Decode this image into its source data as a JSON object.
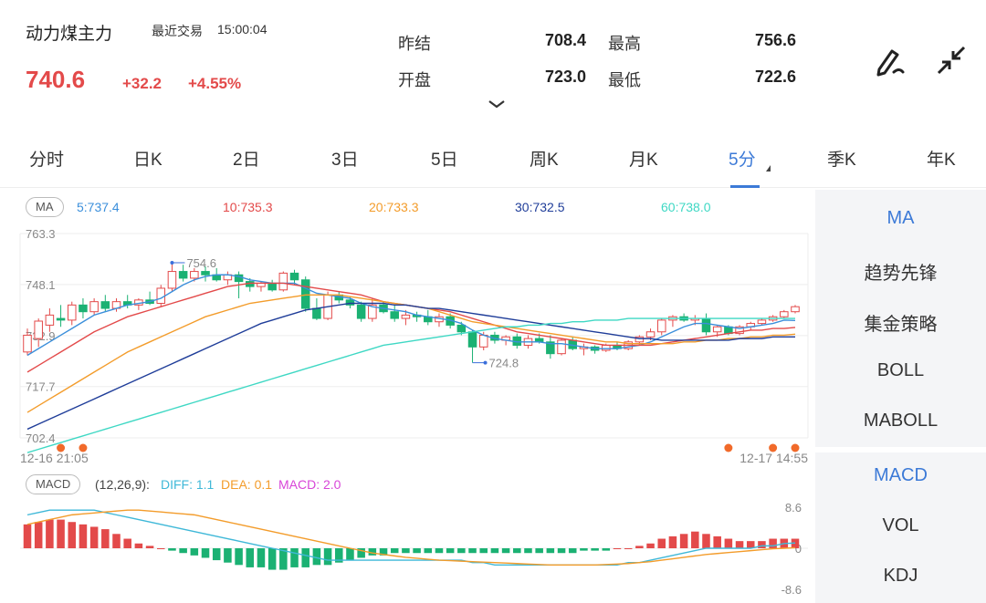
{
  "header": {
    "title": "动力煤主力",
    "trade_label": "最近交易",
    "trade_time": "15:00:04",
    "price": "740.6",
    "change": "+32.2",
    "change_pct": "+4.55%",
    "quotes": {
      "prev_settle_label": "昨结",
      "prev_settle": "708.4",
      "high_label": "最高",
      "high": "756.6",
      "open_label": "开盘",
      "open": "723.0",
      "low_label": "最低",
      "low": "722.6"
    },
    "icons": [
      "draw-icon",
      "collapse-icon",
      "expand-chevron-icon"
    ]
  },
  "tabs": [
    {
      "label": "分时"
    },
    {
      "label": "日K"
    },
    {
      "label": "2日"
    },
    {
      "label": "3日"
    },
    {
      "label": "5日"
    },
    {
      "label": "周K"
    },
    {
      "label": "月K"
    },
    {
      "label": "5分",
      "active": true
    },
    {
      "label": "季K"
    },
    {
      "label": "年K"
    }
  ],
  "ma_legend": {
    "badge": "MA",
    "items": [
      {
        "label": "5:737.4",
        "color": "#3b8fdb"
      },
      {
        "label": "10:735.3",
        "color": "#e34a4a"
      },
      {
        "label": "20:733.3",
        "color": "#f39c2b"
      },
      {
        "label": "30:732.5",
        "color": "#1f3d99"
      },
      {
        "label": "60:738.0",
        "color": "#3fd8c4"
      }
    ]
  },
  "macd_legend": {
    "badge": "MACD",
    "params": "(12,26,9):",
    "diff": "DIFF: 1.1",
    "diff_color": "#3fb8d8",
    "dea": "DEA: 0.1",
    "dea_color": "#f39c2b",
    "macd": "MACD: 2.0",
    "macd_color": "#d846d8"
  },
  "side_panel": {
    "top_items": [
      {
        "label": "MA",
        "active": true
      },
      {
        "label": "趋势先锋"
      },
      {
        "label": "集金策略"
      },
      {
        "label": "BOLL"
      },
      {
        "label": "MABOLL"
      }
    ],
    "bottom_items": [
      {
        "label": "MACD",
        "active": true
      },
      {
        "label": "VOL"
      },
      {
        "label": "KDJ"
      }
    ]
  },
  "chart_data": {
    "type": "candlestick",
    "timeframe": "5分",
    "x_start_label": "12-16 21:05",
    "x_end_label": "12-17 14:55",
    "ylim": [
      702.4,
      763.3
    ],
    "y_ticks": [
      "763.3",
      "748.1",
      "732.9",
      "717.7",
      "702.4"
    ],
    "annotations": {
      "high": "754.6",
      "low": "724.8"
    },
    "candles": [
      [
        728.0,
        735.0,
        727.0,
        733.0
      ],
      [
        732.0,
        738.0,
        729.5,
        737.2
      ],
      [
        736.0,
        741.0,
        734.0,
        739.0
      ],
      [
        738.0,
        742.0,
        735.5,
        737.5
      ],
      [
        737.5,
        743.0,
        736.0,
        742.0
      ],
      [
        742.0,
        744.0,
        738.0,
        740.0
      ],
      [
        740.0,
        744.0,
        739.0,
        743.0
      ],
      [
        743.0,
        745.0,
        740.0,
        741.0
      ],
      [
        741.0,
        744.0,
        740.0,
        743.0
      ],
      [
        743.0,
        745.0,
        741.0,
        742.0
      ],
      [
        742.0,
        744.0,
        740.5,
        743.5
      ],
      [
        743.5,
        746.0,
        742.0,
        742.5
      ],
      [
        742.5,
        748.0,
        741.5,
        747.0
      ],
      [
        747.0,
        754.6,
        746.0,
        752.0
      ],
      [
        752.0,
        754.0,
        749.0,
        750.0
      ],
      [
        750.0,
        753.0,
        749.0,
        752.0
      ],
      [
        752.0,
        753.5,
        749.0,
        751.0
      ],
      [
        751.0,
        753.0,
        749.0,
        749.5
      ],
      [
        749.5,
        752.0,
        748.0,
        751.0
      ],
      [
        751.0,
        752.0,
        744.0,
        749.0
      ],
      [
        749.0,
        750.0,
        746.0,
        747.5
      ],
      [
        747.5,
        749.0,
        746.0,
        748.5
      ],
      [
        748.5,
        749.5,
        746.0,
        746.5
      ],
      [
        746.5,
        752.0,
        746.0,
        751.5
      ],
      [
        751.5,
        752.5,
        748.0,
        749.5
      ],
      [
        749.5,
        750.5,
        740.0,
        741.0
      ],
      [
        741.0,
        744.0,
        737.5,
        738.0
      ],
      [
        738.0,
        746.0,
        737.5,
        745.0
      ],
      [
        745.0,
        746.0,
        742.5,
        743.5
      ],
      [
        743.5,
        744.5,
        741.0,
        742.0
      ],
      [
        742.0,
        743.0,
        737.0,
        738.0
      ],
      [
        738.0,
        744.0,
        737.0,
        742.0
      ],
      [
        742.0,
        743.0,
        739.5,
        740.0
      ],
      [
        740.0,
        742.0,
        737.0,
        738.0
      ],
      [
        738.0,
        740.5,
        736.0,
        739.0
      ],
      [
        739.0,
        740.0,
        737.0,
        738.5
      ],
      [
        738.5,
        740.5,
        736.0,
        737.0
      ],
      [
        737.0,
        739.5,
        735.5,
        738.5
      ],
      [
        738.5,
        739.5,
        735.0,
        736.0
      ],
      [
        736.0,
        737.0,
        733.0,
        734.0
      ],
      [
        734.0,
        734.5,
        724.8,
        729.5
      ],
      [
        729.5,
        734.0,
        728.5,
        733.0
      ],
      [
        733.0,
        734.0,
        730.5,
        731.5
      ],
      [
        731.5,
        733.0,
        730.0,
        732.5
      ],
      [
        732.5,
        733.5,
        729.0,
        730.0
      ],
      [
        730.0,
        733.0,
        729.0,
        732.0
      ],
      [
        732.0,
        733.5,
        730.5,
        731.0
      ],
      [
        731.0,
        733.0,
        726.0,
        727.5
      ],
      [
        727.5,
        732.0,
        727.0,
        731.5
      ],
      [
        731.5,
        732.5,
        728.5,
        729.0
      ],
      [
        729.0,
        730.5,
        727.0,
        729.5
      ],
      [
        729.5,
        730.0,
        727.5,
        728.5
      ],
      [
        728.5,
        730.5,
        728.0,
        730.0
      ],
      [
        730.0,
        731.0,
        728.5,
        729.0
      ],
      [
        729.0,
        731.5,
        728.5,
        731.0
      ],
      [
        731.0,
        733.0,
        730.0,
        732.5
      ],
      [
        732.5,
        735.0,
        731.5,
        734.0
      ],
      [
        734.0,
        738.0,
        733.0,
        737.5
      ],
      [
        737.5,
        739.0,
        735.5,
        738.5
      ],
      [
        738.5,
        739.5,
        737.0,
        737.5
      ],
      [
        737.5,
        739.0,
        736.0,
        738.0
      ],
      [
        738.0,
        739.5,
        733.0,
        734.0
      ],
      [
        734.0,
        736.0,
        732.5,
        735.5
      ],
      [
        735.5,
        736.0,
        733.0,
        733.5
      ],
      [
        733.5,
        736.0,
        733.0,
        735.5
      ],
      [
        735.5,
        737.0,
        734.5,
        736.5
      ],
      [
        736.5,
        738.0,
        736.0,
        737.5
      ],
      [
        737.5,
        739.0,
        737.0,
        738.5
      ],
      [
        738.5,
        740.5,
        738.0,
        740.0
      ],
      [
        740.0,
        742.0,
        739.5,
        741.5
      ]
    ],
    "ma_lines": [
      {
        "name": "MA5",
        "color": "#3b8fdb",
        "values": [
          727,
          729,
          731,
          733,
          735,
          737,
          739,
          740,
          741,
          742,
          742.5,
          743,
          744,
          746,
          748,
          749.5,
          750.5,
          751,
          751,
          750.5,
          749.5,
          749,
          748.5,
          748.5,
          748.5,
          747,
          745.5,
          745,
          744.5,
          744,
          742.5,
          741.5,
          741,
          740.5,
          740,
          739,
          738.5,
          738,
          737.5,
          736.5,
          734.5,
          733,
          732,
          731.5,
          731,
          731,
          731,
          730.5,
          730.5,
          730,
          729.5,
          729,
          729,
          729,
          729.5,
          730,
          731,
          732.5,
          734,
          735.5,
          736.5,
          736.5,
          736,
          735.5,
          735,
          735.5,
          736,
          736.5,
          737.5,
          737.4
        ]
      },
      {
        "name": "MA10",
        "color": "#e34a4a",
        "values": [
          722,
          724,
          726,
          728,
          730,
          732,
          734,
          735.5,
          737,
          738.5,
          739.5,
          740.5,
          741.5,
          742.5,
          743.5,
          744.5,
          745.5,
          746.5,
          747.5,
          748,
          748.5,
          748.5,
          748.5,
          748.5,
          748,
          747.5,
          747,
          746.5,
          746,
          745.5,
          745,
          744,
          743,
          742.5,
          742,
          741.5,
          741,
          740.5,
          740,
          739,
          738,
          737,
          736,
          735,
          734,
          733.5,
          733,
          732.5,
          732,
          731.5,
          731,
          730.5,
          730,
          730,
          730,
          730,
          730,
          730.5,
          731,
          731.5,
          732,
          732.5,
          733,
          733.5,
          734,
          734.5,
          734.5,
          735,
          735,
          735.3
        ]
      },
      {
        "name": "MA20",
        "color": "#f39c2b",
        "values": [
          710,
          712,
          714,
          716,
          718,
          720,
          722,
          724,
          726,
          728,
          729.5,
          731,
          732.5,
          734,
          735.5,
          737,
          738.5,
          739.5,
          740.5,
          741.5,
          742.5,
          743,
          743.5,
          744,
          744.5,
          745,
          745,
          745,
          745,
          744.5,
          744,
          743.5,
          743,
          742.5,
          742,
          741.5,
          741,
          740,
          739,
          738,
          737,
          736.5,
          736,
          735.5,
          735,
          734.5,
          734,
          733.5,
          733,
          732.5,
          732,
          731.5,
          731,
          731,
          730.5,
          730.5,
          730.5,
          730.5,
          730.5,
          731,
          731,
          731.5,
          731.5,
          732,
          732,
          732.5,
          732.5,
          733,
          733,
          733.3
        ]
      },
      {
        "name": "MA30",
        "color": "#1f3d99",
        "values": [
          705,
          706.5,
          708,
          709.5,
          711,
          712.5,
          714,
          715.5,
          717,
          718.5,
          720,
          721.5,
          723,
          724.5,
          726,
          727.5,
          729,
          730.5,
          732,
          733.5,
          735,
          736.5,
          737.5,
          738.5,
          739.5,
          740.5,
          741,
          741.5,
          742,
          742.5,
          742.5,
          742.5,
          742.5,
          742,
          742,
          741.5,
          741,
          741,
          740.5,
          740,
          739.5,
          739,
          738.5,
          738,
          737.5,
          737,
          736.5,
          736,
          735.5,
          735,
          734.5,
          734,
          733.5,
          733,
          732.5,
          732,
          732,
          731.5,
          731.5,
          731.5,
          731.5,
          731.5,
          731.5,
          731.5,
          732,
          732,
          732,
          732.5,
          732.5,
          732.5
        ]
      },
      {
        "name": "MA60",
        "color": "#3fd8c4",
        "values": [
          698,
          699,
          700,
          701,
          702,
          703,
          704,
          705,
          706,
          707,
          708,
          709,
          710,
          711,
          712,
          713,
          714,
          715,
          716,
          717,
          718,
          719,
          720,
          721,
          722,
          723,
          724,
          725,
          726,
          727,
          728,
          729,
          730,
          730.5,
          731,
          731.5,
          732,
          732.5,
          733,
          733.5,
          734,
          734.5,
          735,
          735.5,
          735.5,
          736,
          736,
          736.5,
          736.5,
          737,
          737,
          737.5,
          737.5,
          737.5,
          738,
          738,
          738,
          738,
          738,
          738,
          738,
          738,
          738,
          738,
          738,
          738,
          738,
          738,
          738,
          738
        ]
      }
    ],
    "signal_markers": [
      3,
      5,
      63,
      67,
      71
    ],
    "macd": {
      "y_ticks": [
        "8.6",
        "0",
        "-8.6"
      ],
      "hist": [
        5,
        5.5,
        6,
        6,
        5.5,
        5,
        4.5,
        4,
        3,
        2,
        1,
        0.5,
        0,
        -0.5,
        -1,
        -1.5,
        -2,
        -2.5,
        -3,
        -3.5,
        -4,
        -4,
        -4.5,
        -4.5,
        -4,
        -4,
        -3.5,
        -3.5,
        -3,
        -2.5,
        -2,
        -1.5,
        -1.5,
        -1,
        -1,
        -1,
        -1,
        -1,
        -1,
        -1,
        -1,
        -1,
        -1,
        -1,
        -1,
        -1,
        -1,
        -1,
        -1,
        -1,
        -0.5,
        -0.5,
        -0.5,
        0,
        0,
        0.5,
        1,
        2,
        2.5,
        3,
        3.5,
        3,
        2.5,
        2,
        1.5,
        1.5,
        1.5,
        2,
        2,
        2
      ],
      "diff": [
        7,
        7.5,
        8,
        8,
        8,
        8,
        8,
        7.5,
        7,
        6.5,
        6,
        5.5,
        5,
        4.5,
        4,
        3.5,
        3,
        2.5,
        2,
        1.5,
        1,
        0.5,
        0,
        -0.5,
        -1,
        -1.5,
        -2,
        -2.5,
        -2.5,
        -2.5,
        -2.5,
        -2.5,
        -2.5,
        -2.5,
        -2.5,
        -2.5,
        -2.5,
        -2.5,
        -2.5,
        -2.5,
        -3,
        -3,
        -3.5,
        -3.5,
        -3.5,
        -3.5,
        -3.5,
        -3.5,
        -3.5,
        -3.5,
        -3.5,
        -3.5,
        -3.5,
        -3.5,
        -3,
        -3,
        -2.5,
        -2,
        -1.5,
        -1,
        -0.5,
        0,
        0,
        0,
        0,
        0,
        0.5,
        0.5,
        1,
        1.1
      ],
      "dea": [
        5,
        5.5,
        6,
        6.5,
        7,
        7.2,
        7.4,
        7.6,
        7.8,
        8,
        8,
        7.8,
        7.6,
        7.4,
        7.2,
        7,
        6.5,
        6,
        5.5,
        5,
        4.5,
        4,
        3.5,
        3,
        2.5,
        2,
        1.5,
        1,
        0.5,
        0,
        -0.5,
        -1,
        -1.3,
        -1.6,
        -1.9,
        -2.1,
        -2.3,
        -2.5,
        -2.6,
        -2.7,
        -2.8,
        -2.9,
        -3,
        -3.1,
        -3.2,
        -3.3,
        -3.4,
        -3.5,
        -3.5,
        -3.5,
        -3.5,
        -3.5,
        -3.4,
        -3.3,
        -3.2,
        -3,
        -2.8,
        -2.5,
        -2.2,
        -1.9,
        -1.6,
        -1.3,
        -1.1,
        -0.9,
        -0.7,
        -0.5,
        -0.3,
        -0.1,
        0,
        0.1
      ]
    }
  }
}
